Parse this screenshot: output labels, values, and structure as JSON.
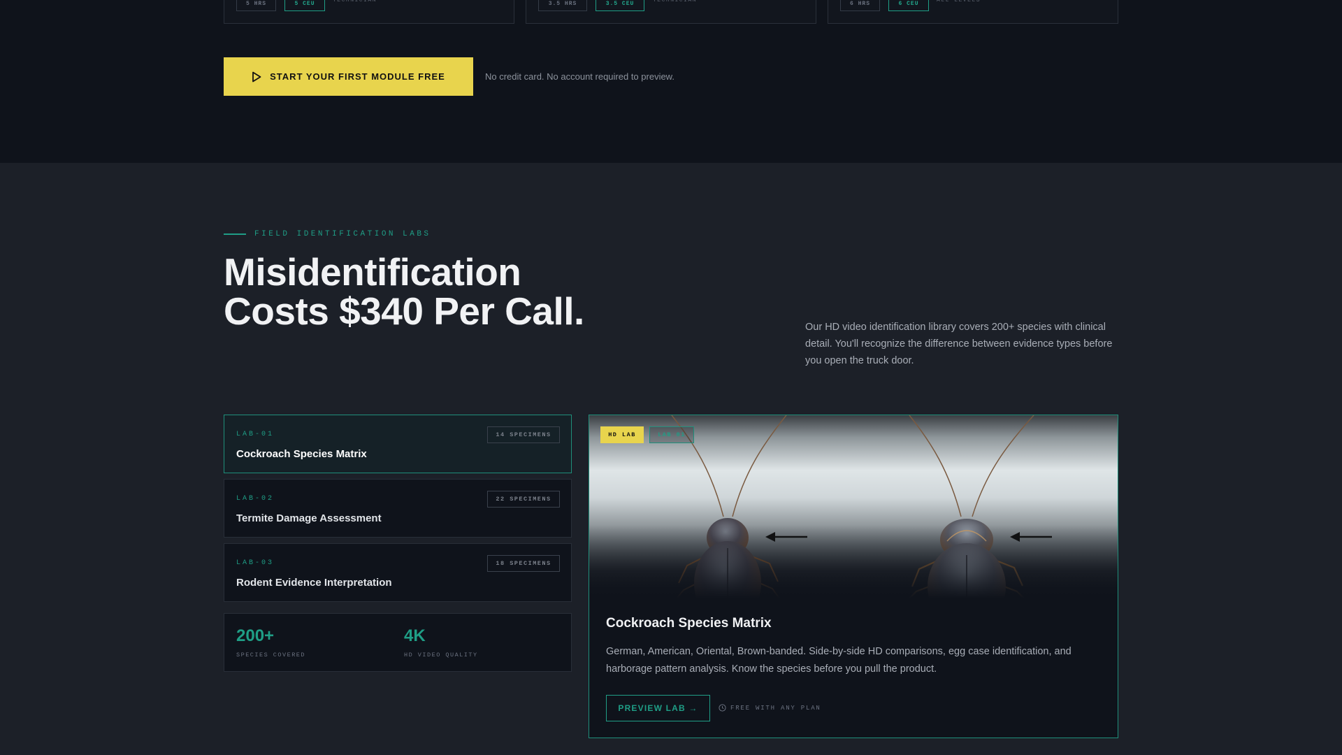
{
  "courses": [
    {
      "hours": "5 HRS",
      "ceu": "5 CEU",
      "level": "TECHNICIAN"
    },
    {
      "hours": "3.5 HRS",
      "ceu": "3.5 CEU",
      "level": "TECHNICIAN"
    },
    {
      "hours": "6 HRS",
      "ceu": "6 CEU",
      "level": "ALL LEVELS"
    }
  ],
  "cta": {
    "label": "START YOUR FIRST MODULE FREE",
    "icon": "play-icon",
    "note": "No credit card. No account required to preview."
  },
  "labs_section": {
    "eyebrow": "FIELD IDENTIFICATION LABS",
    "headline": "Misidentification Costs $340 Per Call.",
    "intro": "Our HD video identification library covers 200+ species with clinical detail. You'll recognize the difference between evidence types before you open the truck door."
  },
  "labs": [
    {
      "code": "LAB-01",
      "title": "Cockroach Species Matrix",
      "count": "14 SPECIMENS",
      "active": true
    },
    {
      "code": "LAB-02",
      "title": "Termite Damage Assessment",
      "count": "22 SPECIMENS",
      "active": false
    },
    {
      "code": "LAB-03",
      "title": "Rodent Evidence Interpretation",
      "count": "18 SPECIMENS",
      "active": false
    }
  ],
  "stats": [
    {
      "value": "200+",
      "label": "SPECIES COVERED"
    },
    {
      "value": "4K",
      "label": "HD VIDEO QUALITY"
    }
  ],
  "preview": {
    "badge_hd": "HD LAB",
    "badge_lab": "LAB 01",
    "image": "cockroach-comparison-image",
    "title": "Cockroach Species Matrix",
    "description": "German, American, Oriental, Brown-banded. Side-by-side HD comparisons, egg case identification, and harborage pattern analysis. Know the species before you pull the product.",
    "button": "PREVIEW LAB →",
    "free_note": "FREE WITH ANY PLAN",
    "free_icon": "clock-icon"
  },
  "colors": {
    "accent_teal": "#1f9e86",
    "accent_yellow": "#e8d44d",
    "bg_dark": "#0f131b",
    "bg_section": "#1c2028"
  }
}
